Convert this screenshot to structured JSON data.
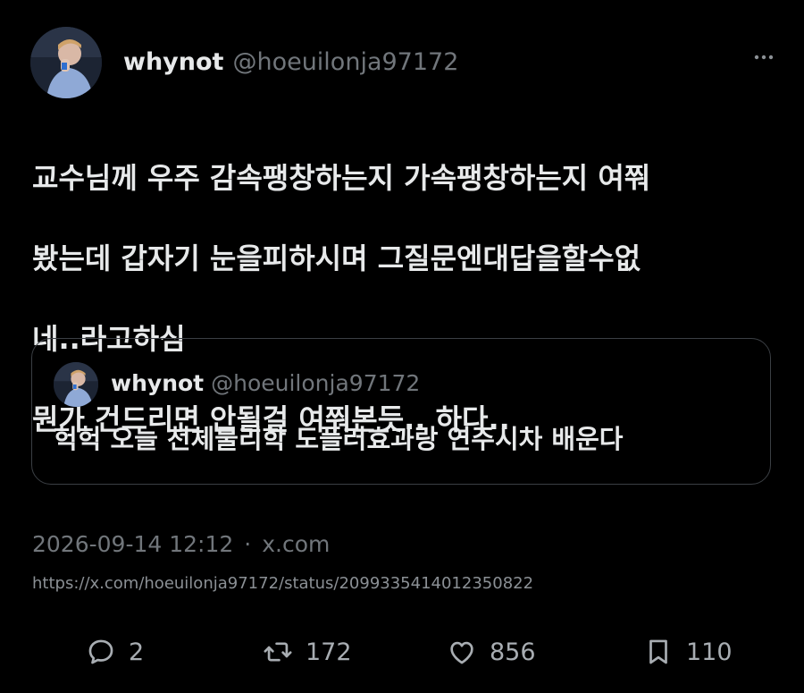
{
  "tweet": {
    "author": {
      "display_name": "whynot",
      "handle": "@hoeuilonja97172"
    },
    "text": "교수님께 우주 감속팽창하는지 가속팽창하는지 여쭤봤는데 갑자기 눈을피하시며 그질문엔대답을할수없네..라고하심\n뭔가 건드리면 안될걸 여쭤본듯.. 하다..",
    "text_lines": [
      "교수님께 우주 감속팽창하는지 가속팽창하는지 여쭤",
      "봤는데 갑자기 눈을피하시며 그질문엔대답을할수없",
      "네..라고하심",
      "뭔가 건드리면 안될걸 여쭤본듯.. 하다.."
    ],
    "quote": {
      "display_name": "whynot",
      "handle": "@hoeuilonja97172",
      "text": "헉헉 오늘 천체물리학 도플러효과랑 연주시차 배운다"
    },
    "timestamp": "2026-09-14 12:12",
    "separator": "·",
    "source": "x.com",
    "url": "https://x.com/hoeuilonja97172/status/2099335414012350822",
    "stats": {
      "replies": "2",
      "retweets": "172",
      "likes": "856",
      "bookmarks": "110"
    }
  },
  "icons": {
    "avatar": "avatar-image",
    "more": "more-dots-icon",
    "reply": "reply-icon",
    "retweet": "retweet-icon",
    "like": "heart-icon",
    "bookmark": "bookmark-icon"
  },
  "colors": {
    "background": "#000000",
    "text": "#e7e9ea",
    "muted": "#71767b",
    "border": "#3b3f44"
  }
}
